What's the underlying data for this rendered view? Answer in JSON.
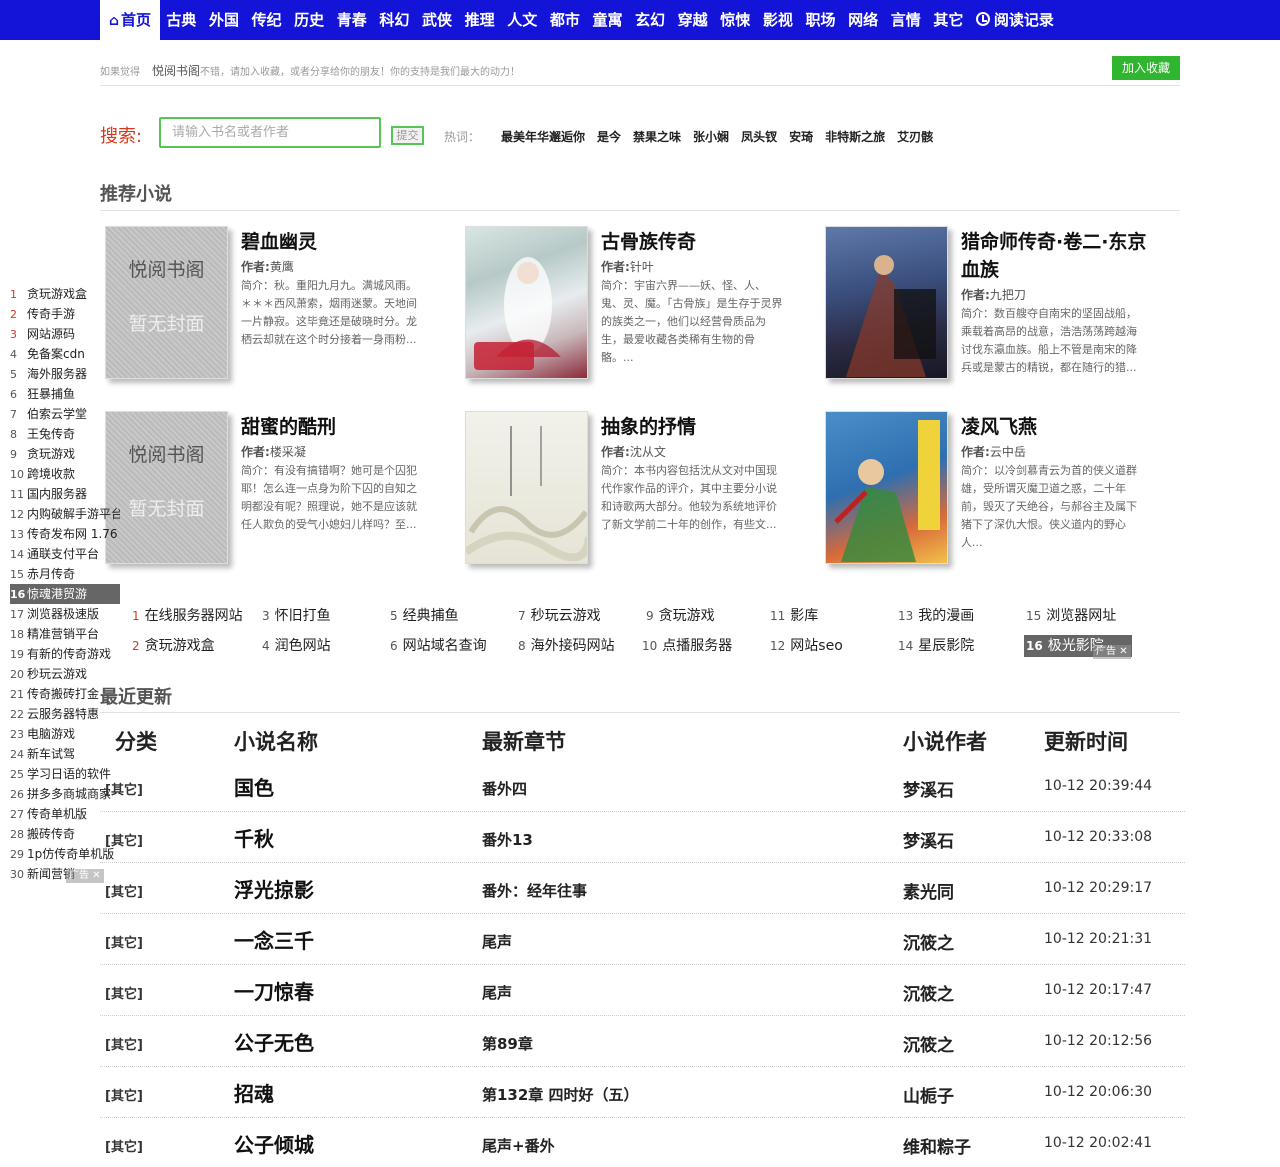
{
  "nav": {
    "items": [
      "首页",
      "古典",
      "外国",
      "传纪",
      "历史",
      "青春",
      "科幻",
      "武侠",
      "推理",
      "人文",
      "都市",
      "童寓",
      "玄幻",
      "穿越",
      "惊悚",
      "影视",
      "职场",
      "网络",
      "言情",
      "其它"
    ],
    "history_label": "阅读记录",
    "home_icon": "home-icon"
  },
  "notice": {
    "prefix": "如果觉得",
    "site": "悦阅书阁",
    "suffix": "不错，请加入收藏，或者分享给你的朋友！你的支持是我们最大的动力！",
    "fav_button": "加入收藏"
  },
  "search": {
    "label": "搜索:",
    "placeholder": "请输入书名或者作者",
    "submit": "提交",
    "hot_label": "热词：",
    "hot_words": [
      "最美年华邂逅你",
      "是今",
      "禁果之味",
      "张小娴",
      "凤头钗",
      "安琦",
      "非特斯之旅",
      "艾刃骸"
    ]
  },
  "recommend": {
    "title": "推荐小说",
    "placeholder_top": "悦阅书阁",
    "placeholder_bottom": "暂无封面",
    "author_prefix": "作者:",
    "desc_prefix": "简介：",
    "books": [
      {
        "title": "碧血幽灵",
        "author": "黄鹰",
        "desc": "秋。重阳九月九。满城风雨。＊＊＊西风萧索，烟雨迷蒙。天地间一片静寂。这毕竟还是破晓时分。龙栖云却就在这个时分接着一身雨粉...",
        "cover": "placeholder"
      },
      {
        "title": "古骨族传奇",
        "author": "针叶",
        "desc": "宇宙六界——妖、怪、人、鬼、灵、魔。「古骨族」是生存于灵界的族类之一，他们以经营骨质品为生，最爱收藏各类稀有生物的骨骼。...",
        "cover": "image"
      },
      {
        "title": "猎命师传奇·卷二·东京血族",
        "author": "九把刀",
        "desc": "数百艘夺自南宋的坚固战船，乘载着高昂的战意，浩浩荡荡跨越海讨伐东瀛血族。船上不管是南宋的降兵或是蒙古的精锐，都在随行的猎...",
        "cover": "image"
      },
      {
        "title": "甜蜜的酷刑",
        "author": "楼采凝",
        "desc": "有没有搞错啊？她可是个囚犯耶！怎么连一点身为阶下囚的自知之明都没有呢？照理说，她不是应该就任人欺负的受气小媳妇儿样吗？至...",
        "cover": "placeholder"
      },
      {
        "title": "抽象的抒情",
        "author": "沈从文",
        "desc": "本书内容包括沈从文对中国现代作家作品的评介，其中主要分小说和诗歌两大部分。他较为系统地评价了新文学前二十年的创作，有些文...",
        "cover": "image"
      },
      {
        "title": "凌风飞燕",
        "author": "云中岳",
        "desc": "以冷剑慕青云为首的侠义道群雄，受所谓灭魔卫道之惑，二十年前，毁灭了天绝谷，与郝谷主及属下猪下了深仇大恨。侠义道内的野心人...",
        "cover": "image"
      }
    ]
  },
  "side_list": [
    "贪玩游戏盒",
    "传奇手游",
    "网站源码",
    "免备案cdn",
    "海外服务器",
    "狂暴捕鱼",
    "伯索云学堂",
    "王兔传奇",
    "贪玩游戏",
    "跨境收款",
    "国内服务器",
    "内购破解手游平台",
    "传奇发布网 1.76",
    "通联支付平台",
    "赤月传奇",
    "惊魂港贸游",
    "浏览器极速版",
    "精准营销平台",
    "有新的传奇游戏",
    "秒玩云游戏",
    "传奇搬砖打金",
    "云服务器特惠",
    "电脑游戏",
    "新车试驾",
    "学习日语的软件",
    "拼多多商城商家",
    "传奇单机版",
    "搬砖传奇",
    "1p仿传奇单机版",
    "新闻营销"
  ],
  "side_ad_tag": "广告",
  "links": [
    "在线服务器网站",
    "贪玩游戏盒",
    "怀旧打鱼",
    "润色网站",
    "经典捕鱼",
    "网站域名查询",
    "秒玩云游戏",
    "海外接码网站",
    "贪玩游戏",
    "点播服务器",
    "影库",
    "网站seo",
    "我的漫画",
    "星辰影院",
    "浏览器网址",
    "极光影院"
  ],
  "links_ad_tag": "广告",
  "recent": {
    "title": "最近更新",
    "headers": {
      "category": "分类",
      "name": "小说名称",
      "chapter": "最新章节",
      "author": "小说作者",
      "time": "更新时间"
    },
    "rows": [
      {
        "category": "[其它]",
        "name": "国色",
        "chapter": "番外四",
        "author": "梦溪石",
        "time": "10-12 20:39:44"
      },
      {
        "category": "[其它]",
        "name": "千秋",
        "chapter": "番外13",
        "author": "梦溪石",
        "time": "10-12 20:33:08"
      },
      {
        "category": "[其它]",
        "name": "浮光掠影",
        "chapter": "番外：经年往事",
        "author": "素光同",
        "time": "10-12 20:29:17"
      },
      {
        "category": "[其它]",
        "name": "一念三千",
        "chapter": "尾声",
        "author": "沉筱之",
        "time": "10-12 20:21:31"
      },
      {
        "category": "[其它]",
        "name": "一刀惊春",
        "chapter": "尾声",
        "author": "沉筱之",
        "time": "10-12 20:17:47"
      },
      {
        "category": "[其它]",
        "name": "公子无色",
        "chapter": "第89章",
        "author": "沉筱之",
        "time": "10-12 20:12:56"
      },
      {
        "category": "[其它]",
        "name": "招魂",
        "chapter": "第132章 四时好（五）",
        "author": "山栀子",
        "time": "10-12 20:06:30"
      },
      {
        "category": "[其它]",
        "name": "公子倾城",
        "chapter": "尾声+番外",
        "author": "维和粽子",
        "time": "10-12 20:02:41"
      }
    ]
  }
}
